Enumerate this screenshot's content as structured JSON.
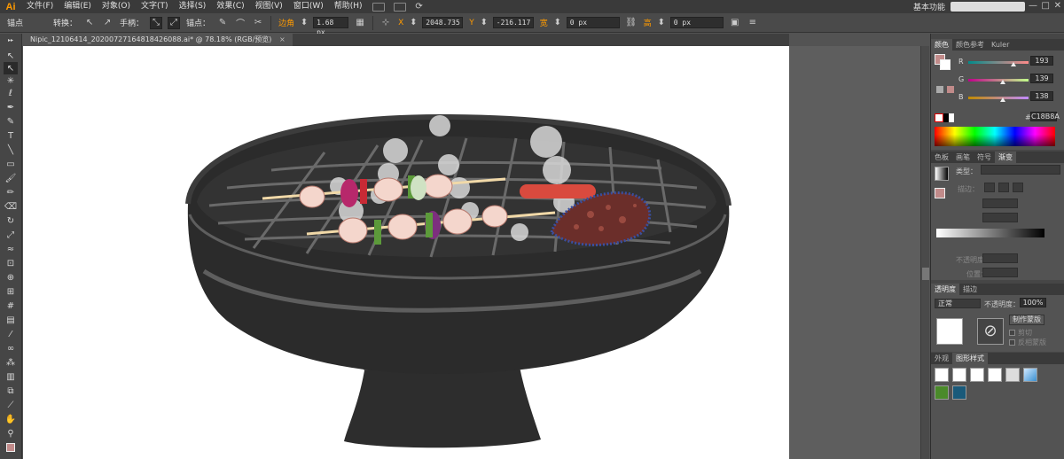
{
  "app": {
    "logo": "Ai"
  },
  "menu": [
    "文件(F)",
    "编辑(E)",
    "对象(O)",
    "文字(T)",
    "选择(S)",
    "效果(C)",
    "视图(V)",
    "窗口(W)",
    "帮助(H)"
  ],
  "workspace": "基本功能",
  "search": {
    "value": ""
  },
  "control_bar": {
    "anchor_label": "锚点",
    "convert_label": "转换：",
    "handle_label": "手柄：",
    "anchor_label2": "锚点：",
    "corner_label": "边角",
    "corner_value": "1.68 px",
    "x_label": "X",
    "x_value": "2048.735",
    "y_label": "Y",
    "y_value": "-216.117",
    "w_label": "宽",
    "w_value": "0 px",
    "h_label": "高",
    "h_value": "0 px"
  },
  "document": {
    "tab_title": "Nipic_12106414_20200727164818426088.ai* @ 78.18% (RGB/预览)",
    "close": "×"
  },
  "color_panel": {
    "tabs": [
      "颜色",
      "颜色参考",
      "Kuler"
    ],
    "r_label": "R",
    "r_value": "193",
    "g_label": "G",
    "g_value": "139",
    "b_label": "B",
    "b_value": "138",
    "hash": "#",
    "hex": "C18B8A",
    "fill_color": "#C18B8A"
  },
  "gradient_panel": {
    "tabs": [
      "色板",
      "画笔",
      "符号",
      "渐变"
    ],
    "type_label": "类型：",
    "stroke_label": "描边：",
    "opacity_label": "不透明度：",
    "location_label": "位置："
  },
  "transparency_panel": {
    "tabs": [
      "透明度",
      "描边"
    ],
    "mode": "正常",
    "opacity_label": "不透明度：",
    "opacity_value": "100%",
    "make_mask": "制作蒙版",
    "clip": "剪切",
    "invert_mask": "反相蒙版"
  },
  "appearance_panel": {
    "tabs": [
      "外观",
      "图形样式"
    ]
  },
  "icons": {
    "selection": "selection-icon",
    "direct": "direct-selection-icon",
    "pen": "pen-icon",
    "type": "type-icon"
  }
}
